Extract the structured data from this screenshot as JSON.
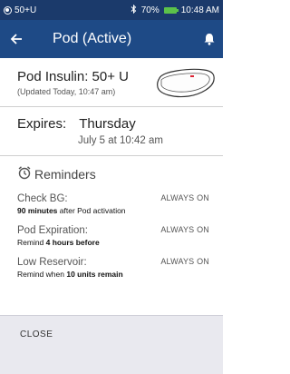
{
  "status_bar": {
    "left_text": "50+U",
    "battery": "70%",
    "time": "10:48 AM",
    "icons": [
      "pod-status-icon",
      "bluetooth-icon",
      "battery-icon"
    ]
  },
  "app_bar": {
    "title": "Pod (Active)",
    "color": "#1e4a86",
    "icons": [
      "back-arrow-icon",
      "bell-icon"
    ]
  },
  "insulin": {
    "title": "Pod Insulin: 50+ U",
    "updated": "(Updated Today, 10:47 am)"
  },
  "expires": {
    "label": "Expires:",
    "day": "Thursday",
    "date": "July 5 at 10:42 am"
  },
  "reminders": {
    "title": "Reminders",
    "items": [
      {
        "name": "Check BG:",
        "desc_bold": "90 minutes",
        "desc_pre": "",
        "desc_post": " after Pod activation",
        "status": "ALWAYS ON"
      },
      {
        "name": "Pod Expiration:",
        "desc_pre": "Remind ",
        "desc_bold": "4 hours before",
        "desc_post": "",
        "status": "ALWAYS ON"
      },
      {
        "name": "Low Reservoir:",
        "desc_pre": "Remind when ",
        "desc_bold": "10 units remain",
        "desc_post": "",
        "status": "ALWAYS ON"
      }
    ]
  },
  "footer": {
    "close_label": "CLOSE"
  }
}
